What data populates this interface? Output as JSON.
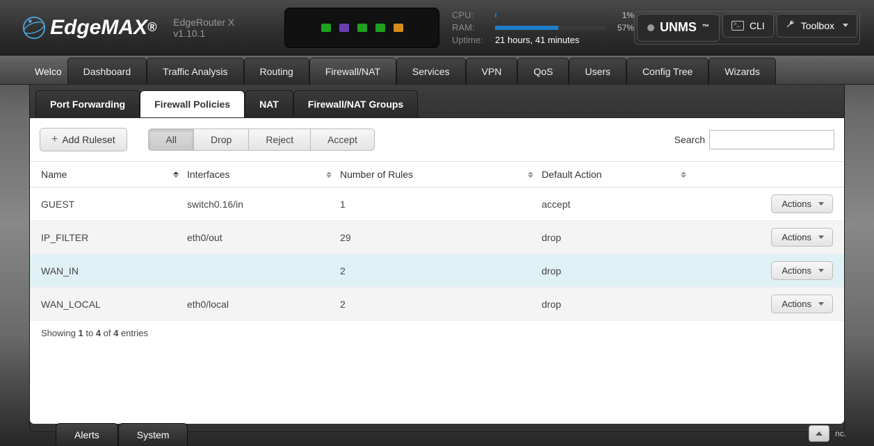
{
  "header": {
    "logo_text": "EdgeMAX",
    "model": "EdgeRouter X v1.10.1",
    "cpu_label": "CPU:",
    "cpu_pct_text": "1%",
    "cpu_pct": 1,
    "ram_label": "RAM:",
    "ram_pct_text": "57%",
    "ram_pct": 57,
    "uptime_label": "Uptime:",
    "uptime_value": "21 hours, 41 minutes",
    "unms": "UNMS",
    "cli": "CLI",
    "toolbox": "Toolbox"
  },
  "main_tabs": {
    "welcome": "Welco",
    "items": [
      "Dashboard",
      "Traffic Analysis",
      "Routing",
      "Firewall/NAT",
      "Services",
      "VPN",
      "QoS",
      "Users",
      "Config Tree",
      "Wizards"
    ],
    "active_index": 3
  },
  "sub_tabs": {
    "items": [
      "Port Forwarding",
      "Firewall Policies",
      "NAT",
      "Firewall/NAT Groups"
    ],
    "active_index": 1
  },
  "toolbar": {
    "add_ruleset": "Add Ruleset",
    "filters": [
      "All",
      "Drop",
      "Reject",
      "Accept"
    ],
    "filter_active": 0,
    "search_label": "Search"
  },
  "table": {
    "columns": [
      "Name",
      "Interfaces",
      "Number of Rules",
      "Default Action"
    ],
    "rows": [
      {
        "name": "GUEST",
        "interfaces": "switch0.16/in",
        "rules": "1",
        "default": "accept"
      },
      {
        "name": "IP_FILTER",
        "interfaces": "eth0/out",
        "rules": "29",
        "default": "drop"
      },
      {
        "name": "WAN_IN",
        "interfaces": "",
        "rules": "2",
        "default": "drop",
        "highlight": true
      },
      {
        "name": "WAN_LOCAL",
        "interfaces": "eth0/local",
        "rules": "2",
        "default": "drop"
      }
    ],
    "actions_label": "Actions",
    "showing_prefix": "Showing ",
    "showing_from": "1",
    "showing_to_word": " to ",
    "showing_to": "4",
    "showing_of_word": " of ",
    "showing_total": "4",
    "showing_suffix": " entries"
  },
  "bottom": {
    "alerts": "Alerts",
    "system": "System",
    "inc": "nc."
  }
}
